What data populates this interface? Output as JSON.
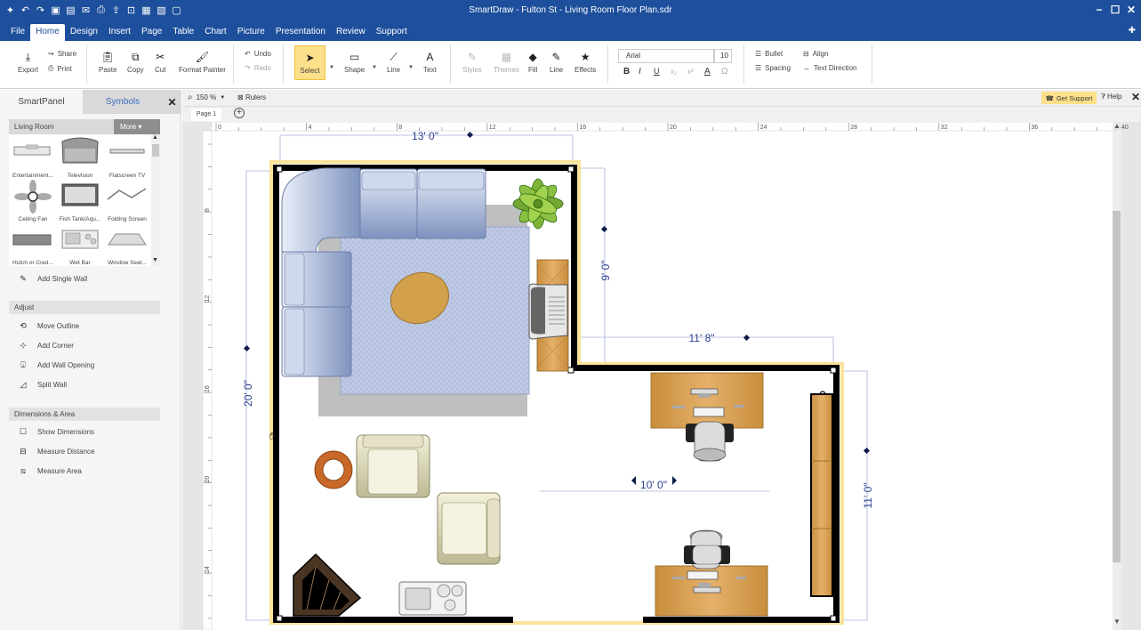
{
  "app": {
    "title": "SmartDraw - Fulton St - Living Room Floor Plan.sdr",
    "window_controls": [
      "−",
      "☐",
      "✕"
    ],
    "quick_access_icons": [
      "app-icon",
      "undo-icon",
      "redo-icon",
      "save-icon",
      "save-all-icon",
      "mail-icon",
      "print-icon",
      "share-icon",
      "export-icon",
      "pdf-icon",
      "image-icon",
      "file-icon"
    ]
  },
  "menu": {
    "items": [
      "File",
      "Home",
      "Design",
      "Insert",
      "Page",
      "Table",
      "Chart",
      "Picture",
      "Presentation",
      "Review",
      "Support"
    ],
    "active": "Home"
  },
  "ribbon": {
    "export": "Export",
    "share": "Share",
    "print": "Print",
    "paste": "Paste",
    "copy": "Copy",
    "cut": "Cut",
    "format_painter": "Format Painter",
    "undo": "Undo",
    "redo": "Redo",
    "select": "Select",
    "shape": "Shape",
    "line": "Line",
    "text": "Text",
    "styles": "Styles",
    "themes": "Themes",
    "fill": "Fill",
    "line2": "Line",
    "effects": "Effects",
    "font_name": "Arial",
    "font_size": "10",
    "bold": "B",
    "italic": "I",
    "underline": "U",
    "subscript": "x₂",
    "superscript": "x²",
    "font_color": "A",
    "special": "Ω",
    "bullet": "Bullet",
    "align": "Align",
    "spacing": "Spacing",
    "text_direction": "Text Direction"
  },
  "left_panel": {
    "tabs": [
      "SmartPanel",
      "Symbols"
    ],
    "close": "✕",
    "library": "Living Room",
    "more": "More ▾",
    "symbols": [
      "Entertainment...",
      "Television",
      "Flatscreen TV",
      "Ceiling Fan",
      "Fish Tank/Aqu...",
      "Folding Screen",
      "Hutch or Cred...",
      "Wet Bar",
      "Window Seat..."
    ],
    "add_single_wall": "Add Single Wall",
    "adjust_title": "Adjust",
    "adjust_items": [
      "Move Outline",
      "Add Corner",
      "Add Wall Opening",
      "Split Wall"
    ],
    "dimensions_title": "Dimensions & Area",
    "dimension_items": [
      "Show Dimensions",
      "Measure Distance",
      "Measure Area"
    ]
  },
  "view_bar": {
    "zoom": "150 %",
    "rulers": "Rulers",
    "get_support": "Get Support",
    "help": "Help",
    "close": "✕"
  },
  "page_bar": {
    "page": "Page 1",
    "add": "+"
  },
  "ruler": {
    "top_labels": [
      "0",
      "4",
      "8",
      "12",
      "16",
      "20",
      "24",
      "28",
      "32",
      "36",
      "40"
    ],
    "left_labels": [
      "8",
      "12",
      "16",
      "20",
      "24"
    ]
  },
  "dimensions": {
    "top": "13' 0\"",
    "left": "20' 0\"",
    "upper_right": "9' 0\"",
    "middle": "11' 8\"",
    "interior": "10' 0\"",
    "right": "11' 0\""
  },
  "colors": {
    "title_bar": "#1d4f9c",
    "accent_highlight": "#fde08a",
    "dimension_text": "#2a3f8f",
    "wall": "#000000",
    "desk_wood": "#d9a45a",
    "sofa": "#aab8d6",
    "rug": "#b3bfdc"
  }
}
